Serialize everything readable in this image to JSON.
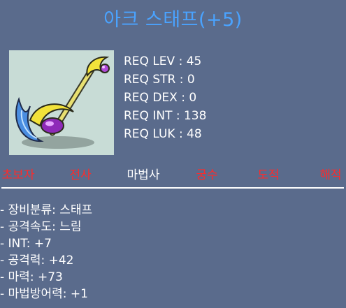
{
  "item": {
    "title": "아크 스태프(+5)",
    "icon_name": "arc-staff-icon"
  },
  "requirements": [
    {
      "label": "REQ LEV : 45"
    },
    {
      "label": "REQ STR : 0"
    },
    {
      "label": "REQ DEX : 0"
    },
    {
      "label": "REQ INT : 138"
    },
    {
      "label": "REQ LUK : 48"
    }
  ],
  "jobs": [
    {
      "label": "초보자",
      "color": "#ff2a2a",
      "eligible": false
    },
    {
      "label": "전사",
      "color": "#ff2a2a",
      "eligible": false
    },
    {
      "label": "마법사",
      "color": "#ffffff",
      "eligible": true
    },
    {
      "label": "궁수",
      "color": "#ff2a2a",
      "eligible": false
    },
    {
      "label": "도적",
      "color": "#ff2a2a",
      "eligible": false
    },
    {
      "label": "해적",
      "color": "#ff2a2a",
      "eligible": false
    }
  ],
  "stats": [
    {
      "label": "- 장비분류: 스태프"
    },
    {
      "label": "- 공격속도: 느림"
    },
    {
      "label": "- INT: +7"
    },
    {
      "label": "- 공격력: +42"
    },
    {
      "label": "- 마력: +73"
    },
    {
      "label": "- 마법방어력: +1"
    }
  ],
  "colors": {
    "background": "#5a6b8c",
    "title": "#4aa3ff",
    "ineligible_job": "#ff2a2a",
    "eligible_job": "#ffffff"
  }
}
